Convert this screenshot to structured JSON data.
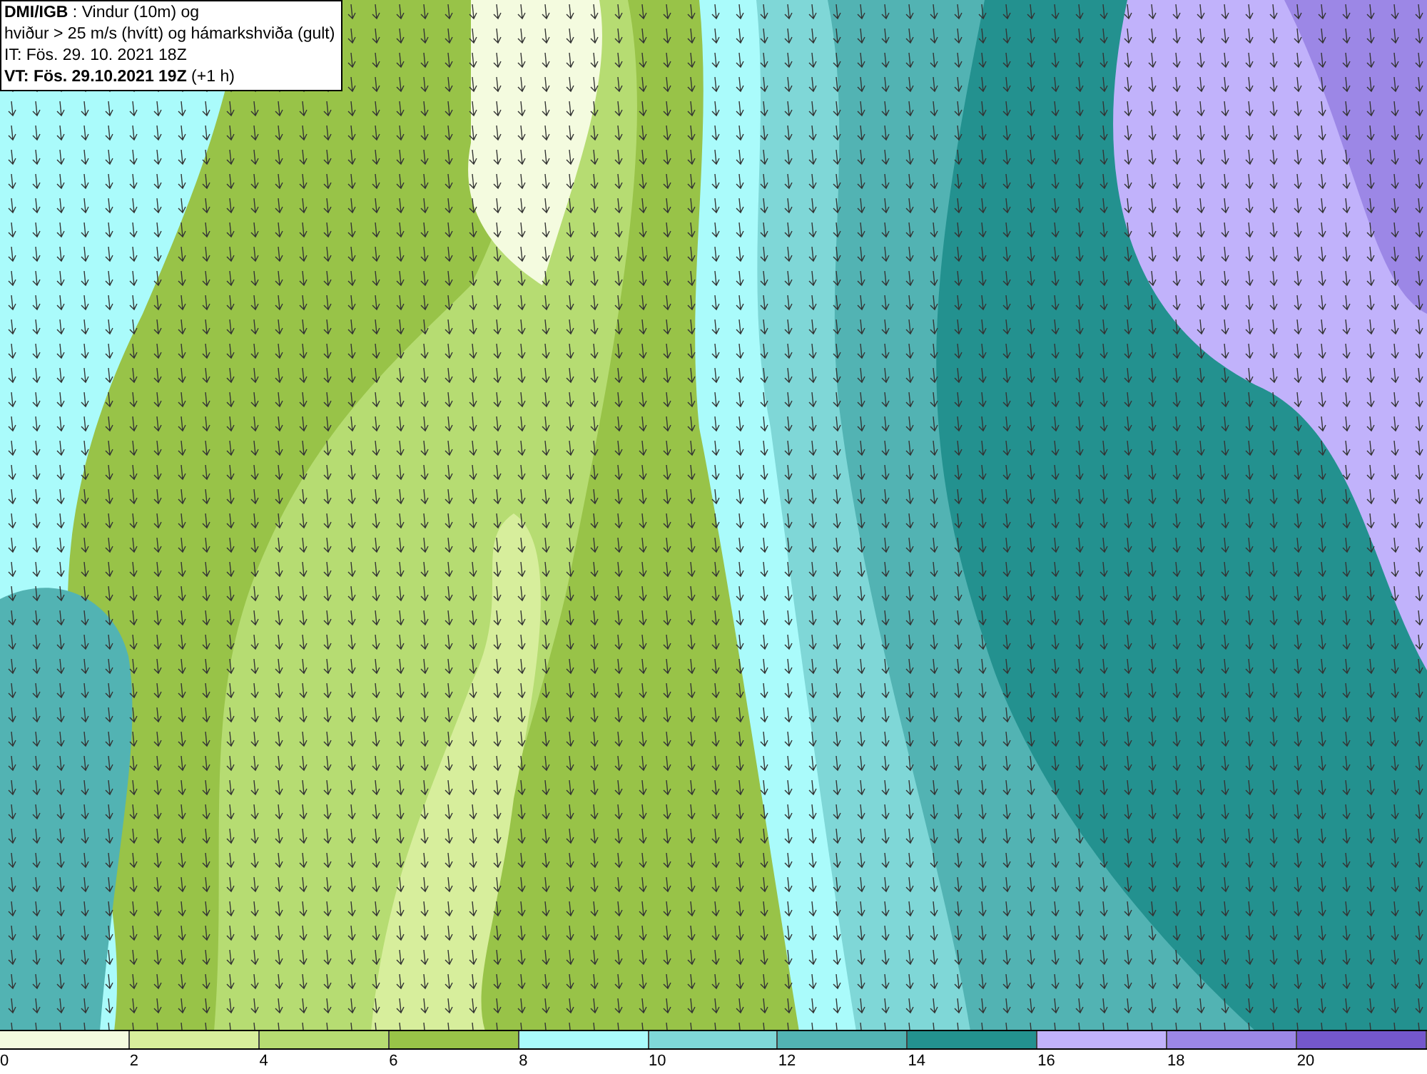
{
  "info_box": {
    "lines": [
      "**DMI/IGB** : Vindur (10m) og",
      "hviður > 25 m/s (hvítt) og hámarkshviða (gult)",
      "IT: Fös. 29. 10. 2021 18Z",
      "**VT: Fös. 29.10.2021 19Z** (+1 h)"
    ]
  },
  "legend": {
    "segments": [
      {
        "color": "#f4fbdf"
      },
      {
        "color": "#d7ee9c"
      },
      {
        "color": "#b6dc72"
      },
      {
        "color": "#98c348"
      },
      {
        "color": "#aafbfb"
      },
      {
        "color": "#7fd7d7"
      },
      {
        "color": "#52b3b3"
      },
      {
        "color": "#23918f"
      },
      {
        "color": "#c1b2fb"
      },
      {
        "color": "#9c87e6"
      },
      {
        "color": "#7457cc"
      }
    ],
    "ticks": [
      "0",
      "2",
      "4",
      "6",
      "8",
      "10",
      "12",
      "14",
      "16",
      "18",
      "20"
    ]
  }
}
